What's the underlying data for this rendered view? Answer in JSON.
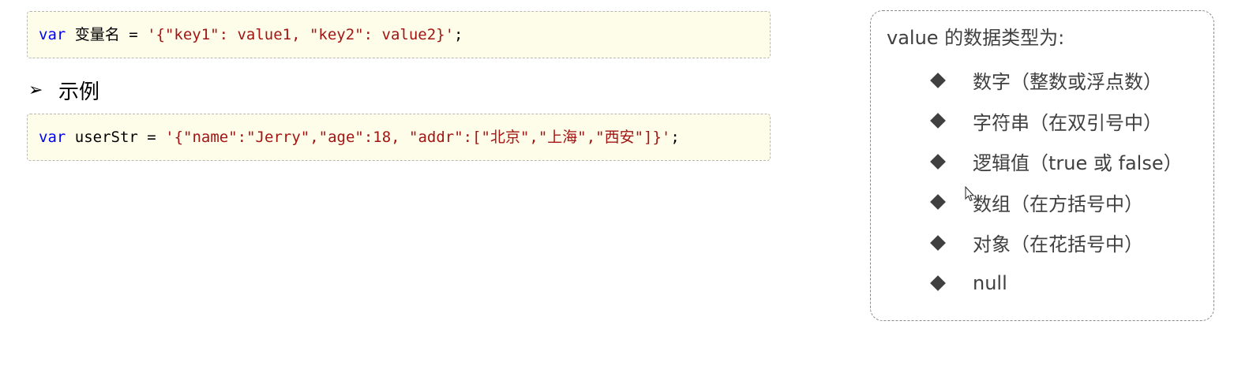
{
  "code_example_1": {
    "kw": "var",
    "plain": " 变量名 = ",
    "str": "'{\"key1\": value1, \"key2\": value2}'",
    "end": ";"
  },
  "section": {
    "marker": "➢",
    "heading": "示例"
  },
  "code_example_2": {
    "kw": "var",
    "plain": " userStr = ",
    "str": "'{\"name\":\"Jerry\",\"age\":18, \"addr\":[\"北京\",\"上海\",\"西安\"]}'",
    "end": ";"
  },
  "value_types": {
    "title": "value 的数据类型为:",
    "items": [
      "数字（整数或浮点数）",
      "字符串（在双引号中）",
      "逻辑值（true 或 false）",
      "数组（在方括号中）",
      "对象（在花括号中）",
      "null"
    ]
  },
  "colors": {
    "keyword": "#0000ff",
    "string": "#a31515",
    "code_background": "#fefde9",
    "panel_text": "#404040"
  }
}
